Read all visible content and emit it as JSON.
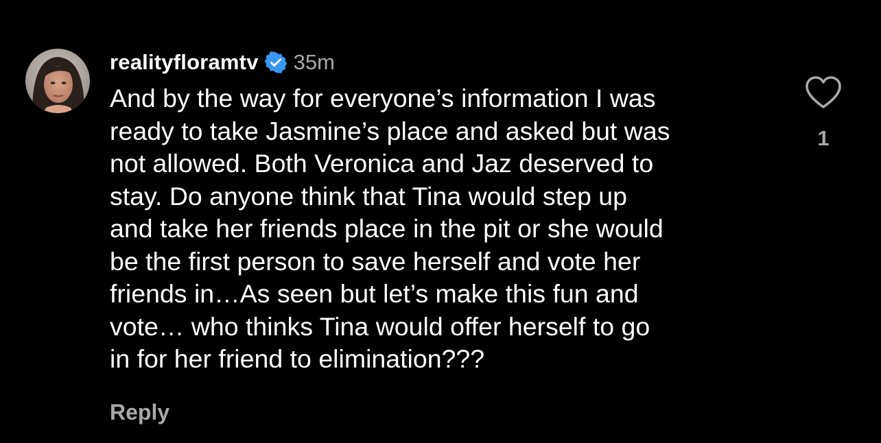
{
  "comment": {
    "username": "realityfloramtv",
    "verified_icon": "verified-badge-icon",
    "timestamp": "35m",
    "text": "And by the way for everyone’s information I was\nready to take Jasmine’s place and asked but was\nnot allowed. Both Veronica and Jaz deserved to\nstay. Do anyone think that Tina would step up\nand take her friends place in the pit or she would\nbe the first person to save herself and vote her\nfriends in…As seen but let’s make this fun and\nvote… who thinks Tina would offer herself to go\nin for her friend to elimination???",
    "reply_label": "Reply",
    "like_icon": "heart-outline-icon",
    "like_count": "1"
  },
  "colors": {
    "background": "#000000",
    "text": "#ffffff",
    "muted": "#a8a8a8",
    "verified": "#3897f0"
  }
}
